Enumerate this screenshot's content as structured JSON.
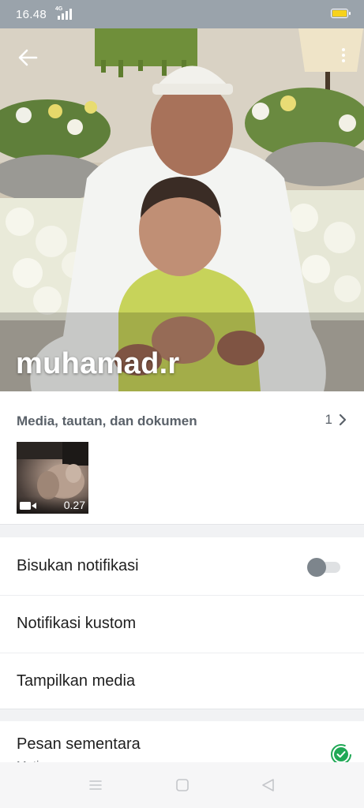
{
  "status_bar": {
    "time": "16.48",
    "network": "4G",
    "battery_color": "#f7d21c"
  },
  "header": {
    "contact_name": "muhamad.r",
    "back_icon": "arrow-back-icon",
    "menu_icon": "more-vert-icon"
  },
  "media": {
    "title": "Media, tautan, dan dokumen",
    "count": "1",
    "items": [
      {
        "type": "video",
        "duration": "0.27",
        "icon": "video-camera-icon"
      }
    ]
  },
  "settings": {
    "mute_label": "Bisukan notifikasi",
    "mute_enabled": false,
    "custom_notifications_label": "Notifikasi kustom",
    "show_media_label": "Tampilkan media"
  },
  "disappearing": {
    "label": "Pesan sementara",
    "status": "Mati",
    "icon": "timer-icon",
    "accent": "#1fa855"
  },
  "nav_bar": {
    "recents_icon": "menu-lines-icon",
    "home_icon": "square-home-icon",
    "back_icon": "triangle-back-icon"
  }
}
